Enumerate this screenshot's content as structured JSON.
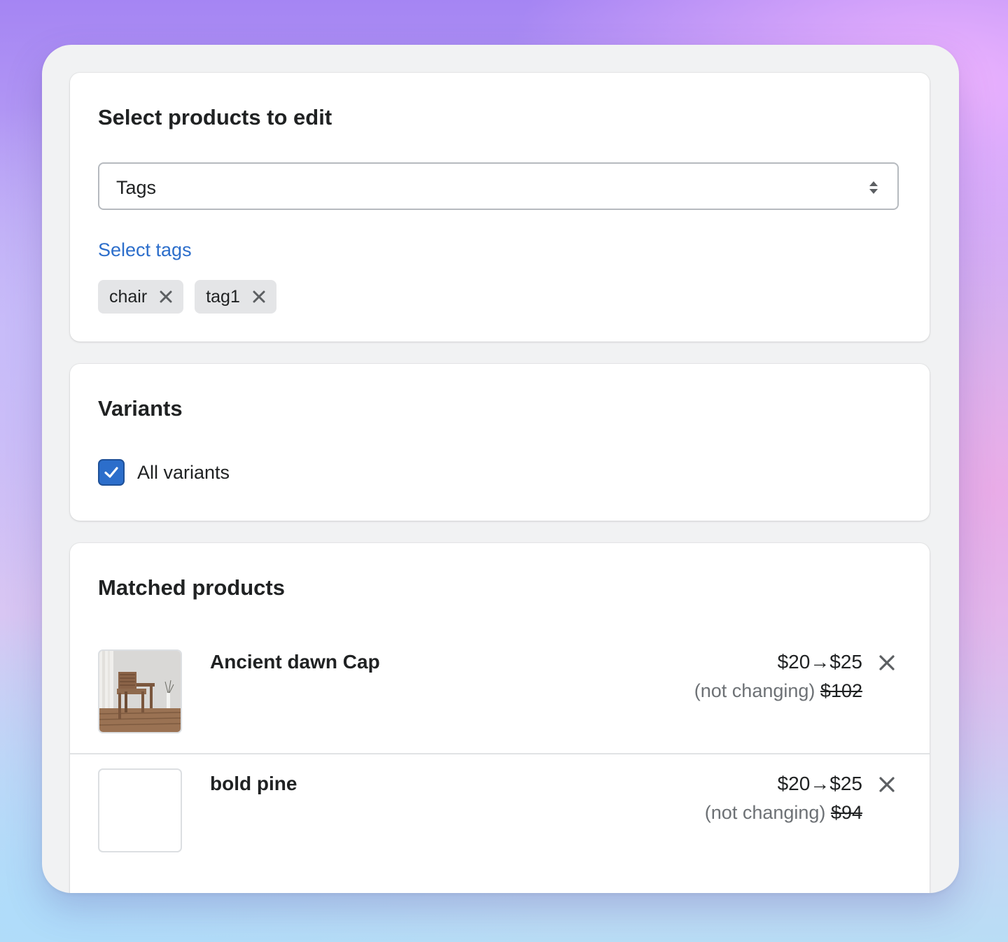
{
  "select_section": {
    "title": "Select products to edit",
    "select_value": "Tags",
    "link_label": "Select tags",
    "tags": [
      {
        "label": "chair"
      },
      {
        "label": "tag1"
      }
    ]
  },
  "variants_section": {
    "title": "Variants",
    "checkbox_label": "All variants",
    "checked": true
  },
  "matched_section": {
    "title": "Matched products",
    "products": [
      {
        "name": "Ancient dawn Cap",
        "price": "$20→$25",
        "note": "(not changing)",
        "old_price": "$102",
        "has_image": true
      },
      {
        "name": "bold pine",
        "price": "$20→$25",
        "note": "(not changing)",
        "old_price": "$94",
        "has_image": false
      }
    ]
  },
  "colors": {
    "accent": "#2c6ecb",
    "card": "#ffffff",
    "frame": "#f1f2f3"
  }
}
